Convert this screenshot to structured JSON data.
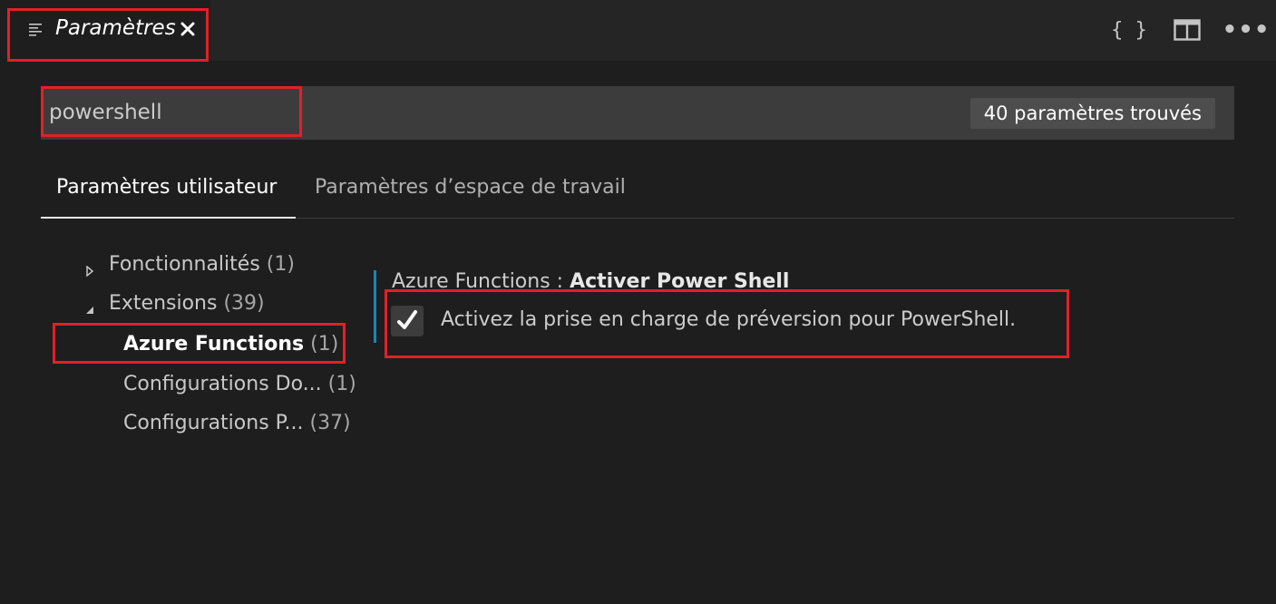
{
  "tab": {
    "label": "Paramètres",
    "icon": "settings-list-icon",
    "close_icon": "close-icon"
  },
  "actions": [
    {
      "name": "open-json-icon",
      "glyph": "{ }"
    },
    {
      "name": "split-editor-icon",
      "glyph": ""
    },
    {
      "name": "more-actions-icon",
      "glyph": "•••"
    }
  ],
  "search": {
    "value": "powershell",
    "result_count": "40 paramètres trouvés"
  },
  "scope_tabs": {
    "user": "Paramètres utilisateur",
    "workspace": "Paramètres d’espace de travail"
  },
  "toc": [
    {
      "label": "Fonctionnalités",
      "count": "(1)",
      "expanded": false
    },
    {
      "label": "Extensions",
      "count": "(39)",
      "expanded": true
    },
    {
      "label": "Azure Functions",
      "count": "(1)",
      "selected": true
    },
    {
      "label": "Configurations Do...",
      "count": "(1)"
    },
    {
      "label": "Configurations P...",
      "count": "(37)"
    }
  ],
  "setting": {
    "category": "Azure Functions : ",
    "name": "Activer Power Shell",
    "description": "Activez la prise en charge de préversion pour PowerShell.",
    "checked": true
  },
  "colors": {
    "highlight": "#e32027",
    "modified_bar": "#1a85b8",
    "background": "#1e1e1e"
  }
}
